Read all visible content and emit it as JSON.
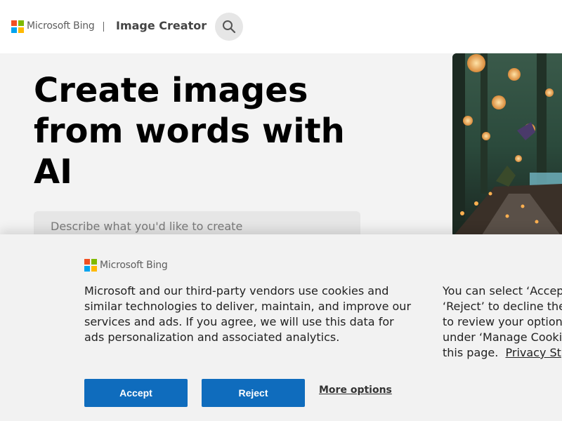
{
  "header": {
    "brand": "Microsoft Bing",
    "app_title": "Image Creator",
    "search_icon": "search-icon"
  },
  "hero": {
    "title": "Create images from words with AI",
    "prompt_placeholder": "Describe what you'd like to create"
  },
  "cookie_banner": {
    "brand": "Microsoft Bing",
    "text": "Microsoft and our third-party vendors use cookies and similar technologies to deliver, maintain, and improve our services and ads. If you agree, we will use this data for ads personalization and associated analytics.",
    "right_lines": [
      "You can select ‘Accept",
      "‘Reject’ to decline the",
      "to review your options",
      "under ‘Manage Cooki",
      "this page."
    ],
    "privacy_link": "Privacy St",
    "accept_label": "Accept",
    "reject_label": "Reject",
    "more_options_label": "More options"
  },
  "colors": {
    "accent": "#0f6cbd",
    "logo_red": "#f25022",
    "logo_green": "#7fba00",
    "logo_blue": "#00a4ef",
    "logo_yellow": "#ffb900"
  }
}
